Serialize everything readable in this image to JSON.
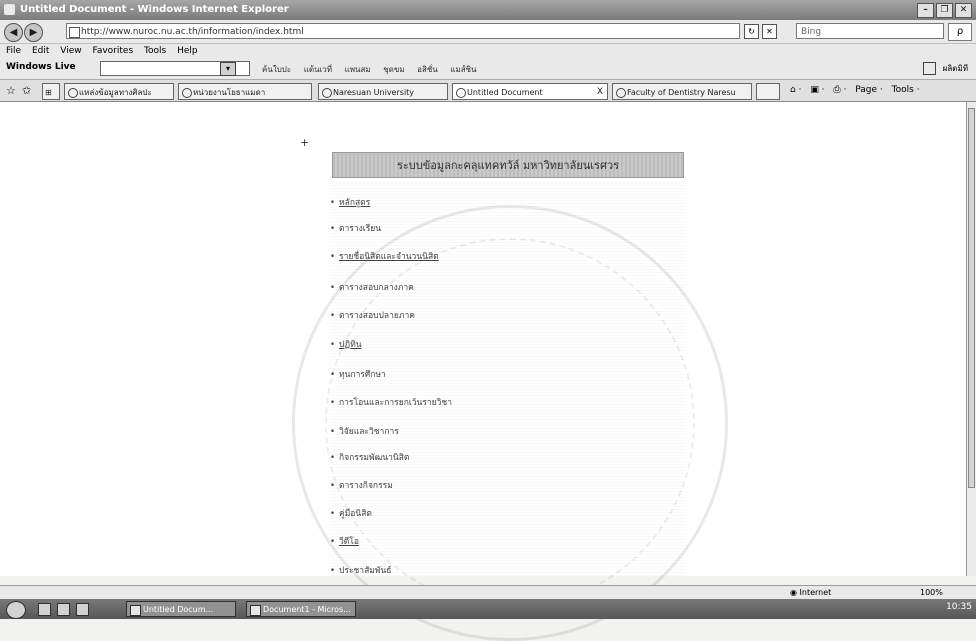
{
  "window": {
    "title": "Untitled Document - Windows Internet Explorer"
  },
  "window_controls": {
    "minimize": "–",
    "restore": "❐",
    "close": "✕"
  },
  "address": {
    "url": "http://www.nuroc.nu.ac.th/information/index.html",
    "search_placeholder": "Bing",
    "nav_back": "◀",
    "nav_forward": "▶",
    "refresh": "↻",
    "stop": "✕",
    "search_button": "ρ"
  },
  "menu": {
    "items": [
      "File",
      "Edit",
      "View",
      "Favorites",
      "Tools",
      "Help"
    ]
  },
  "livebar": {
    "logo": "Windows Live",
    "search_button": "▾",
    "links": [
      "ค้นใบปะ",
      "แต้นเวที่",
      "แพนสม",
      "ชุดขม",
      "อสิชั่น",
      "แมส์ชิน"
    ],
    "right": "ผลิตมิที"
  },
  "tabs": [
    {
      "label": "แหล่งข้อมูลทางศิลปะ"
    },
    {
      "label": "หน่วยงานโยธาแมดา"
    },
    {
      "label": "Naresuan University"
    },
    {
      "label": "Untitled Document",
      "close": "X"
    },
    {
      "label": "Faculty of Dentistry Naresu"
    }
  ],
  "tab_tools": {
    "home": "⌂ ·",
    "feeds": "▣ ·",
    "print": "⎙ ·",
    "page": "Page ·",
    "tools": "Tools ·"
  },
  "page": {
    "header": "ระบบข้อมูลกะคลุแทคทวัล์ มหาวิทยาลัยนเรศวร",
    "cursor": "+",
    "links": [
      {
        "label": "หลักสูตร",
        "underline": true
      },
      {
        "label": "ตารางเรียน",
        "underline": false
      },
      {
        "label": "รายชื่อนิสิตและจำนวนนิสิต",
        "underline": true
      },
      {
        "label": "ตารางสอบกลางภาค",
        "underline": false
      },
      {
        "label": "ตารางสอบปลายภาค",
        "underline": false
      },
      {
        "label": "ปฏิทิน",
        "underline": true
      },
      {
        "label": "ทุนการศึกษา",
        "underline": false
      },
      {
        "label": "การโอนและการยกเว้นรายวิชา",
        "underline": false
      },
      {
        "label": "วิจัยและวิชาการ",
        "underline": false
      },
      {
        "label": "กิจกรรมพัฒนานิสิต",
        "underline": false
      },
      {
        "label": "ตารางกิจกรรม",
        "underline": false
      },
      {
        "label": "คู่มือนิสิต",
        "underline": false
      },
      {
        "label": "วีดีโอ",
        "underline": true
      },
      {
        "label": "ประชาสัมพันธ์",
        "underline": false
      }
    ]
  },
  "status": {
    "zone": "Internet",
    "zoom": "100%"
  },
  "taskbar": {
    "buttons": [
      "Untitled Docum...",
      "Document1 - Micros..."
    ],
    "clock": "10:35"
  }
}
